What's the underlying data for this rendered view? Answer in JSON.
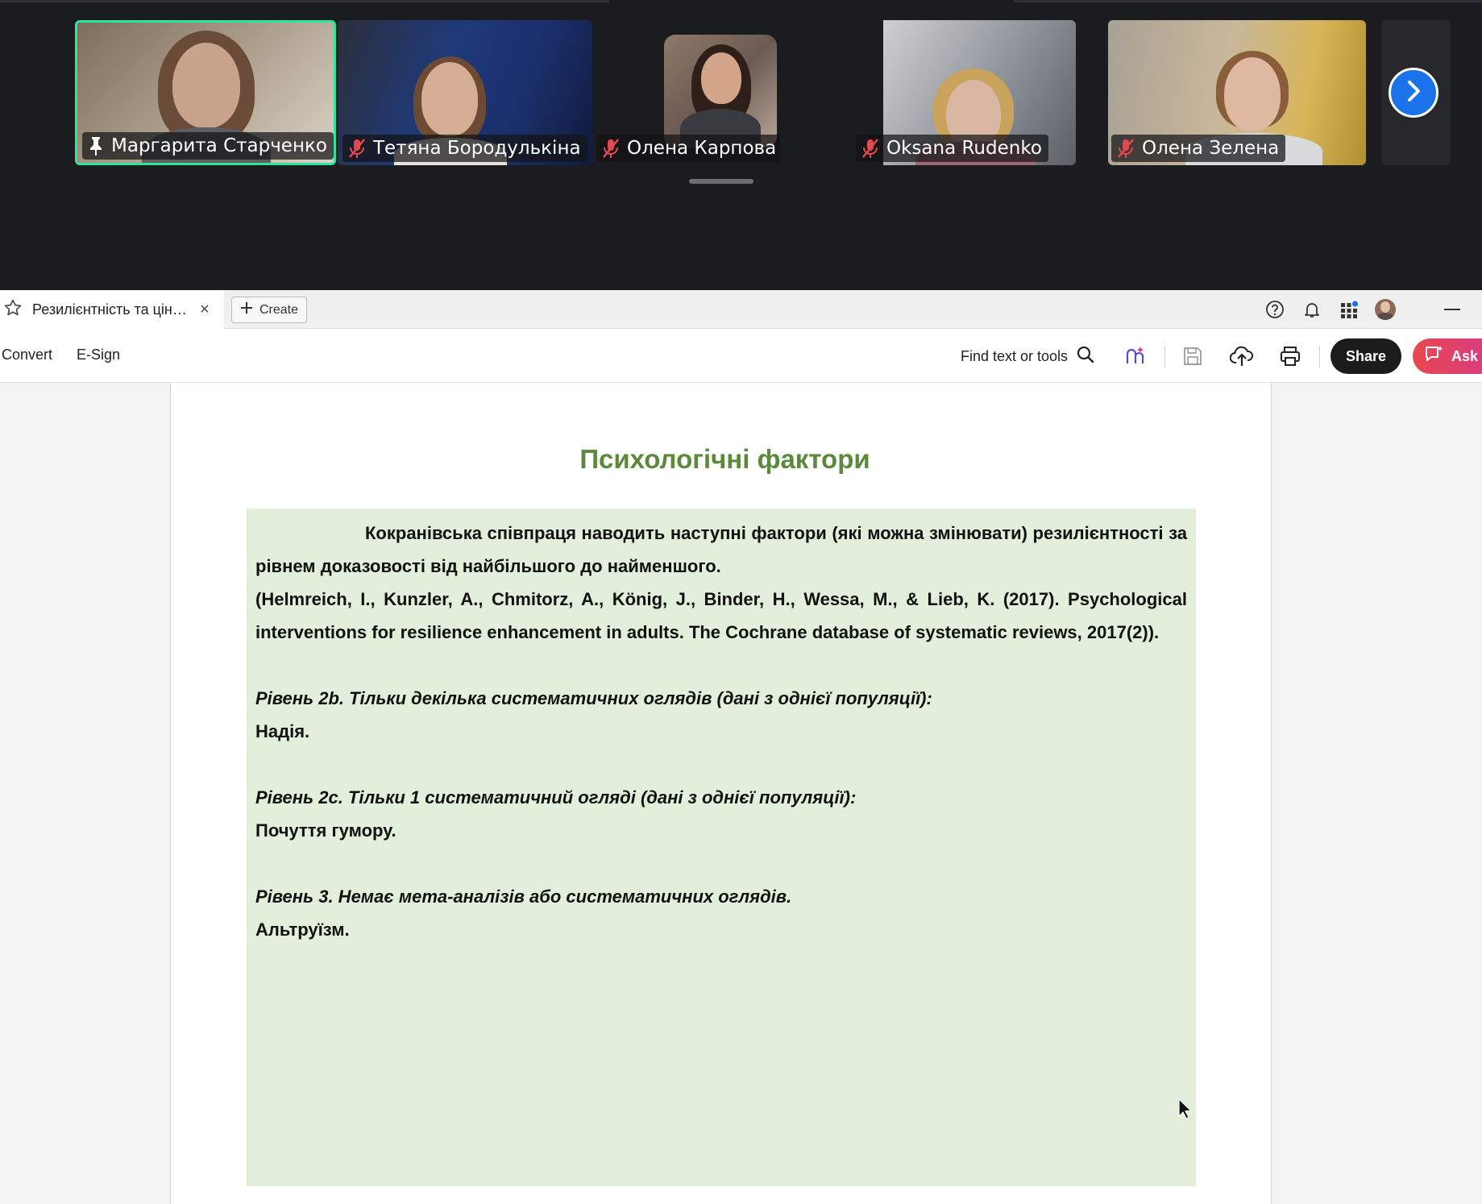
{
  "meeting": {
    "participants": [
      {
        "name": "Маргарита Старченко",
        "status": "pinned",
        "active": true
      },
      {
        "name": "Тетяна Бородулькіна",
        "status": "muted",
        "active": false
      },
      {
        "name": "Олена Карпова",
        "status": "muted",
        "active": false
      },
      {
        "name": "Oksana Rudenko",
        "status": "muted",
        "active": false
      },
      {
        "name": "Олена Зелена",
        "status": "muted",
        "active": false
      }
    ],
    "next_icon": "chevron-right-icon",
    "colors": {
      "active_border": "#2ee59d",
      "muted_mic": "#e5484d",
      "next_button": "#1a73e8"
    }
  },
  "acrobat": {
    "tab": {
      "title": "Резилієнтність та цінні...",
      "close": "×"
    },
    "create_label": "Create",
    "menu": {
      "convert": "Convert",
      "esign": "E-Sign"
    },
    "find_label": "Find text or tools",
    "share_label": "Share",
    "ask_label": "Ask A"
  },
  "document": {
    "title": "Психологічні фактори",
    "intro": "Кокранівська співпраця наводить наступні фактори (які можна змінювати) резилієнтності за рівнем доказовості від найбільшого до найменшого.",
    "citation": "(Helmreich, I., Kunzler, A., Chmitorz, A., König, J., Binder, H., Wessa, M., & Lieb, K. (2017). Psychological interventions for resilience enhancement in adults. The Cochrane database of systematic reviews, 2017(2)).",
    "levels": [
      {
        "heading": "Рівень 2b. Тільки декілька систематичних оглядів (дані з однієї популяції):",
        "factor": "Надія."
      },
      {
        "heading": "Рівень 2c. Тільки 1 систематичний огляді (дані з однієї популяції):",
        "factor": "Почуття гумору."
      },
      {
        "heading": "Рівень 3. Немає мета-аналізів або систематичних оглядів.",
        "factor": "Альтруїзм."
      }
    ],
    "colors": {
      "title": "#5a8a3a",
      "box_background": "#e2efda"
    }
  }
}
